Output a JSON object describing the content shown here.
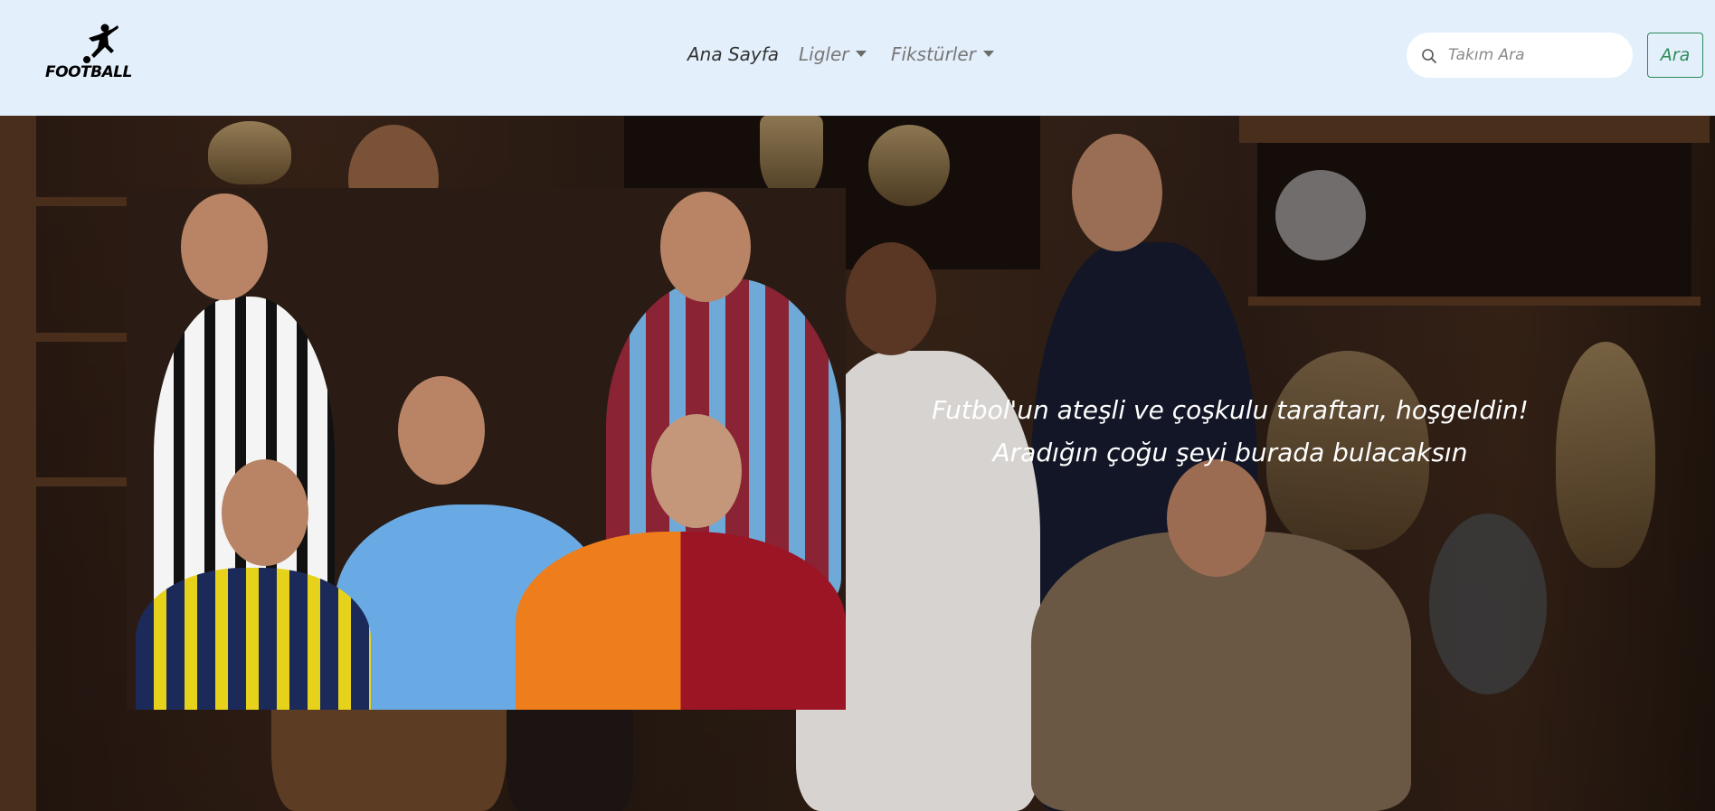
{
  "navbar": {
    "logo_text": "FOOTBALL",
    "links": [
      {
        "label": "Ana Sayfa",
        "dropdown": false,
        "active": true
      },
      {
        "label": "Ligler",
        "dropdown": true,
        "active": false
      },
      {
        "label": "Fikstürler",
        "dropdown": true,
        "active": false
      }
    ],
    "search": {
      "placeholder": "Takım Ara",
      "value": ""
    },
    "search_button_label": "Ara"
  },
  "hero": {
    "line1": "Futbol'un ateşli ve çoşkulu taraftarı, hoşgeldin!",
    "line2": "Aradığın çoğu şeyi burada bulacaksın"
  },
  "colors": {
    "navbar_bg": "#e3effb",
    "accent": "#2e8b57",
    "hero_text": "#ffffff"
  },
  "icons": [
    "football-player-logo-icon",
    "search-icon",
    "chevron-down-icon"
  ]
}
